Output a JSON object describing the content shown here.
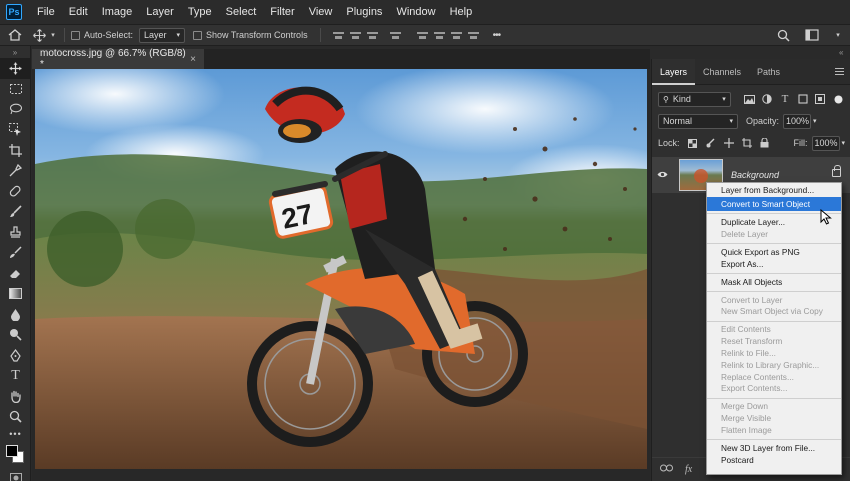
{
  "app": {
    "logo": "Ps"
  },
  "menubar": [
    "File",
    "Edit",
    "Image",
    "Layer",
    "Type",
    "Select",
    "Filter",
    "View",
    "Plugins",
    "Window",
    "Help"
  ],
  "options": {
    "auto_select_label": "Auto-Select:",
    "auto_select_value": "Layer",
    "transform_label": "Show Transform Controls",
    "more": "•••"
  },
  "document": {
    "tab_title": "motocross.jpg @ 66.7% (RGB/8) *",
    "close": "×"
  },
  "layers_panel": {
    "tabs": [
      "Layers",
      "Channels",
      "Paths"
    ],
    "filter_kind": "Kind",
    "blend_mode": "Normal",
    "opacity_label": "Opacity:",
    "opacity_value": "100%",
    "lock_label": "Lock:",
    "fill_label": "Fill:",
    "fill_value": "100%",
    "layer_name": "Background",
    "footer_icons": [
      "link-icon",
      "fx-icon"
    ]
  },
  "context_menu": {
    "items": [
      {
        "label": "Layer from Background...",
        "state": "enabled"
      },
      {
        "label": "Convert to Smart Object",
        "state": "highlighted"
      },
      {
        "sep": true
      },
      {
        "label": "Duplicate Layer...",
        "state": "enabled"
      },
      {
        "label": "Delete Layer",
        "state": "disabled"
      },
      {
        "sep": true
      },
      {
        "label": "Quick Export as PNG",
        "state": "enabled"
      },
      {
        "label": "Export As...",
        "state": "enabled"
      },
      {
        "sep": true
      },
      {
        "label": "Mask All Objects",
        "state": "enabled"
      },
      {
        "sep": true
      },
      {
        "label": "Convert to Layer",
        "state": "disabled"
      },
      {
        "label": "New Smart Object via Copy",
        "state": "disabled"
      },
      {
        "sep": true
      },
      {
        "label": "Edit Contents",
        "state": "disabled"
      },
      {
        "label": "Reset Transform",
        "state": "disabled"
      },
      {
        "label": "Relink to File...",
        "state": "disabled"
      },
      {
        "label": "Relink to Library Graphic...",
        "state": "disabled"
      },
      {
        "label": "Replace Contents...",
        "state": "disabled"
      },
      {
        "label": "Export Contents...",
        "state": "disabled"
      },
      {
        "sep": true
      },
      {
        "label": "Merge Down",
        "state": "disabled"
      },
      {
        "label": "Merge Visible",
        "state": "disabled"
      },
      {
        "label": "Flatten Image",
        "state": "disabled"
      },
      {
        "sep": true
      },
      {
        "label": "New 3D Layer from File...",
        "state": "enabled"
      },
      {
        "label": "Postcard",
        "state": "enabled"
      }
    ]
  },
  "toolbar": {
    "tools": [
      "move-tool-icon",
      "marquee-tool-icon",
      "lasso-tool-icon",
      "object-selection-tool-icon",
      "crop-tool-icon",
      "eyedropper-tool-icon",
      "healing-brush-tool-icon",
      "brush-tool-icon",
      "clone-stamp-tool-icon",
      "history-brush-tool-icon",
      "eraser-tool-icon",
      "gradient-tool-icon",
      "blur-tool-icon",
      "dodge-tool-icon",
      "pen-tool-icon",
      "type-tool-icon",
      "hand-tool-icon",
      "zoom-tool-icon",
      "more-tools-icon"
    ]
  },
  "photo": {
    "numbers": [
      "27"
    ]
  }
}
